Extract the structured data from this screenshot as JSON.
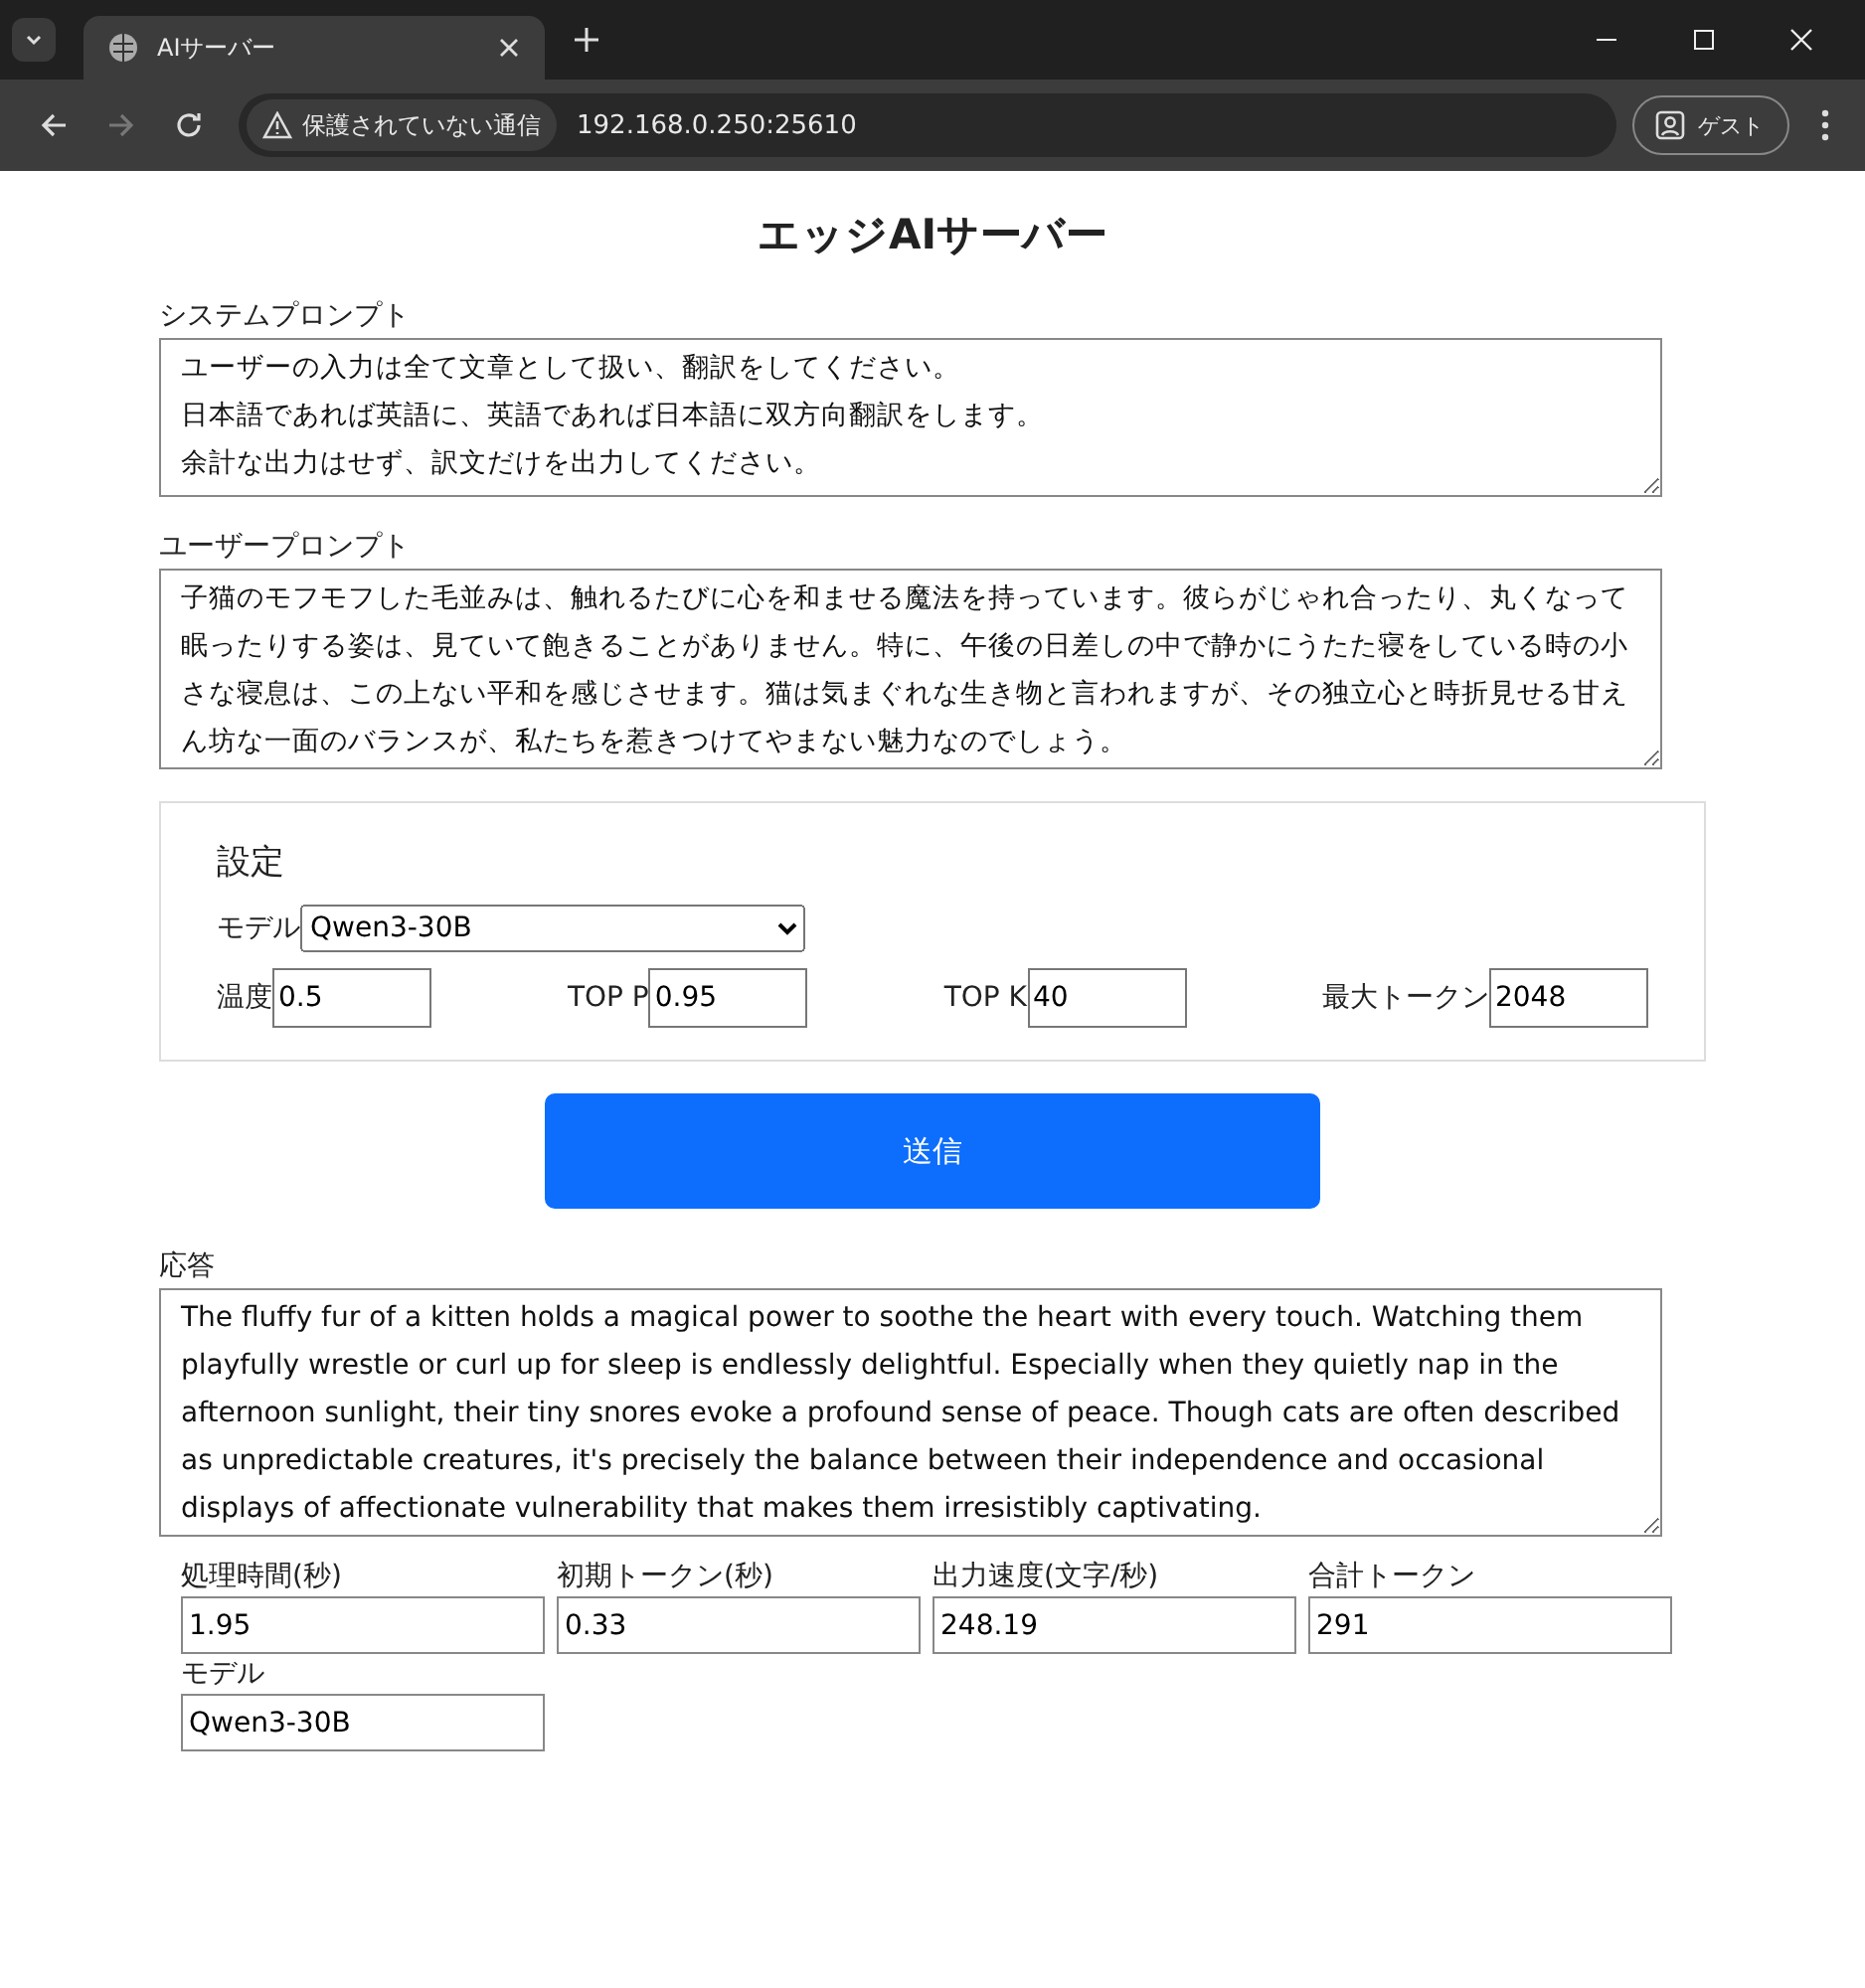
{
  "browser": {
    "tab": {
      "title": "AIサーバー"
    },
    "forward_disabled": true,
    "security_label": "保護されていない通信",
    "url": "192.168.0.250:25610",
    "profile_label": "ゲスト"
  },
  "page": {
    "title": "エッジAIサーバー",
    "system_prompt": {
      "label": "システムプロンプト",
      "lines": [
        "ユーザーの入力は全て文章として扱い、翻訳をしてください。",
        "日本語であれば英語に、英語であれば日本語に双方向翻訳をします。",
        "余計な出力はせず、訳文だけを出力してください。"
      ]
    },
    "user_prompt": {
      "label": "ユーザープロンプト",
      "value": "子猫のモフモフした毛並みは、触れるたびに心を和ませる魔法を持っています。彼らがじゃれ合ったり、丸くなって眠ったりする姿は、見ていて飽きることがありません。特に、午後の日差しの中で静かにうたた寝をしている時の小さな寝息は、この上ない平和を感じさせます。猫は気まぐれな生き物と言われますが、その独立心と時折見せる甘えん坊な一面のバランスが、私たちを惹きつけてやまない魅力なのでしょう。"
    },
    "settings": {
      "legend": "設定",
      "model": {
        "label": "モデル",
        "value": "Qwen3-30B"
      },
      "params": [
        {
          "label": "温度",
          "value": "0.5"
        },
        {
          "label": "TOP P",
          "value": "0.95"
        },
        {
          "label": "TOP K",
          "value": "40"
        },
        {
          "label": "最大トークン",
          "value": "2048"
        }
      ]
    },
    "submit_button": "送信",
    "response": {
      "label": "応答",
      "value": "The fluffy fur of a kitten holds a magical power to soothe the heart with every touch. Watching them playfully wrestle or curl up for sleep is endlessly delightful. Especially when they quietly nap in the afternoon sunlight, their tiny snores evoke a profound sense of peace. Though cats are often described as unpredictable creatures, it's precisely the balance between their independence and occasional displays of affectionate vulnerability that makes them irresistibly captivating."
    },
    "metrics": [
      {
        "label": "処理時間(秒)",
        "value": "1.95"
      },
      {
        "label": "初期トークン(秒)",
        "value": "0.33"
      },
      {
        "label": "出力速度(文字/秒)",
        "value": "248.19"
      },
      {
        "label": "合計トークン",
        "value": "291"
      },
      {
        "label": "モデル",
        "value": "Qwen3-30B"
      }
    ]
  }
}
